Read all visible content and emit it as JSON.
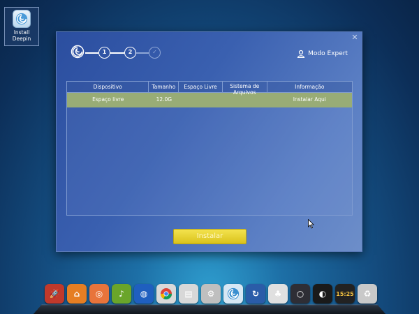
{
  "desktop": {
    "shortcut_label": "Install Deepin"
  },
  "installer": {
    "steps": [
      "1",
      "2"
    ],
    "expert_mode_label": "Modo Expert",
    "table": {
      "headers": [
        "Dispositivo",
        "Tamanho",
        "Espaço Livre",
        "Sistema de Arquivos",
        "Informação"
      ],
      "rows": [
        [
          "Espaço livre",
          "12.0G",
          "",
          "",
          "Instalar Aqui"
        ]
      ]
    },
    "install_button": "Instalar"
  },
  "dock": {
    "items": [
      {
        "icon": "rocket-launcher-icon",
        "color": "#c0392b"
      },
      {
        "icon": "software-center-icon",
        "color": "#e67e22"
      },
      {
        "icon": "music-player-icon",
        "color": "#e8743b"
      },
      {
        "icon": "deepin-music-icon",
        "color": "#6aa52a"
      },
      {
        "icon": "browser-globe-icon",
        "color": "#1f5fbf"
      },
      {
        "icon": "chrome-icon",
        "color": "#d9d9d9"
      },
      {
        "icon": "file-manager-icon",
        "color": "#d8d8d8"
      },
      {
        "icon": "system-settings-icon",
        "color": "#bfbfbf"
      },
      {
        "icon": "deepin-installer-icon",
        "color": "#d6e7f4"
      },
      {
        "icon": "update-icon",
        "color": "#2a5ca8"
      },
      {
        "icon": "terminal-icon",
        "color": "#e0e0e0"
      },
      {
        "icon": "search-icon",
        "color": "#2e2e35"
      },
      {
        "icon": "deepin-movie-icon",
        "color": "#1a1a1a"
      },
      {
        "icon": "clock-icon",
        "color": "#222"
      },
      {
        "icon": "trash-icon",
        "color": "#c9c9c9"
      }
    ],
    "clock_text": "15:25"
  }
}
